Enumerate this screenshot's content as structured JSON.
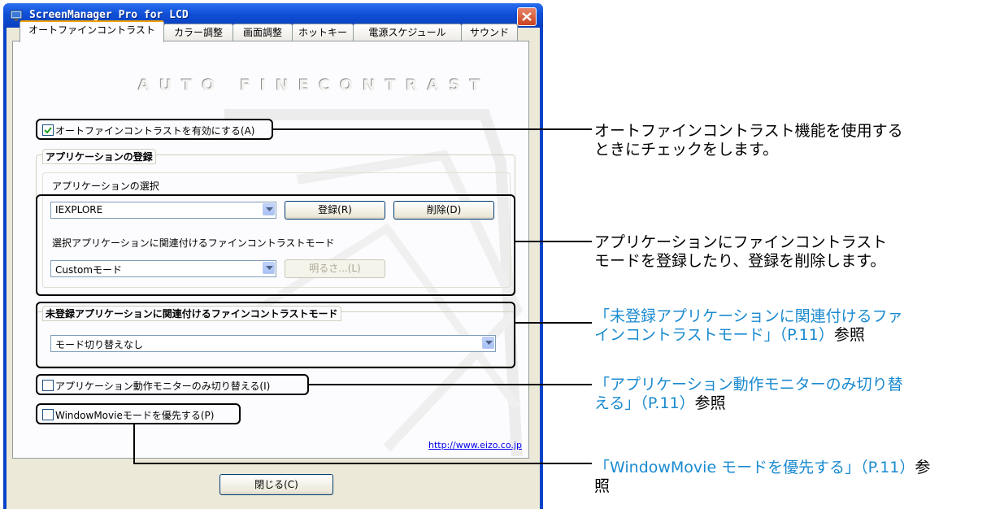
{
  "window": {
    "title": "ScreenManager Pro for LCD",
    "tabs": [
      "オートファインコントラスト",
      "カラー調整",
      "画面調整",
      "ホットキー",
      "電源スケジュール",
      "サウンド"
    ],
    "active_tab": 0
  },
  "panel": {
    "logo_text": "AUTO FINECONTRAST",
    "enable_checkbox": {
      "label": "オートファインコントラストを有効にする(A)",
      "checked": true
    },
    "app_registration": {
      "group_title": "アプリケーションの登録",
      "select_label": "アプリケーションの選択",
      "app_combo_value": "IEXPLORE",
      "register_button": "登録(R)",
      "delete_button": "削除(D)",
      "mode_label": "選択アプリケーションに関連付けるファインコントラストモード",
      "mode_combo_value": "Customモード",
      "brightness_button": "明るさ...(L)"
    },
    "unregistered": {
      "group_title": "未登録アプリケーションに関連付けるファインコントラストモード",
      "combo_value": "モード切り替えなし"
    },
    "monitor_switch_checkbox": {
      "label": "アプリケーション動作モニターのみ切り替える(I)",
      "checked": false
    },
    "windowmovie_checkbox": {
      "label": "WindowMovieモードを優先する(P)",
      "checked": false
    },
    "url": "http://www.eizo.co.jp"
  },
  "close_button": "閉じる(C)",
  "annotations": {
    "a1_line1": "オートファインコントラスト機能を使用する",
    "a1_line2": "ときにチェックをします。",
    "a2_line1": "アプリケーションにファインコントラスト",
    "a2_line2": "モードを登録したり、登録を削除します。",
    "a3_line1": "「未登録アプリケーションに関連付けるファ",
    "a3_line2_link": "インコントラストモード」（P.11）",
    "a3_line2_tail": "参照",
    "a4_line1": "「アプリケーション動作モニターのみ切り替",
    "a4_line2_link": "える」（P.11）",
    "a4_line2_tail": "参照",
    "a5_line1_link": "「WindowMovie モードを優先する」（P.11）",
    "a5_line1_tail": "参",
    "a5_line2": "照"
  },
  "colors": {
    "title_bar": "#0a43c8",
    "annotation_link": "#1a8ad0",
    "panel_bg": "#ece9d8"
  }
}
